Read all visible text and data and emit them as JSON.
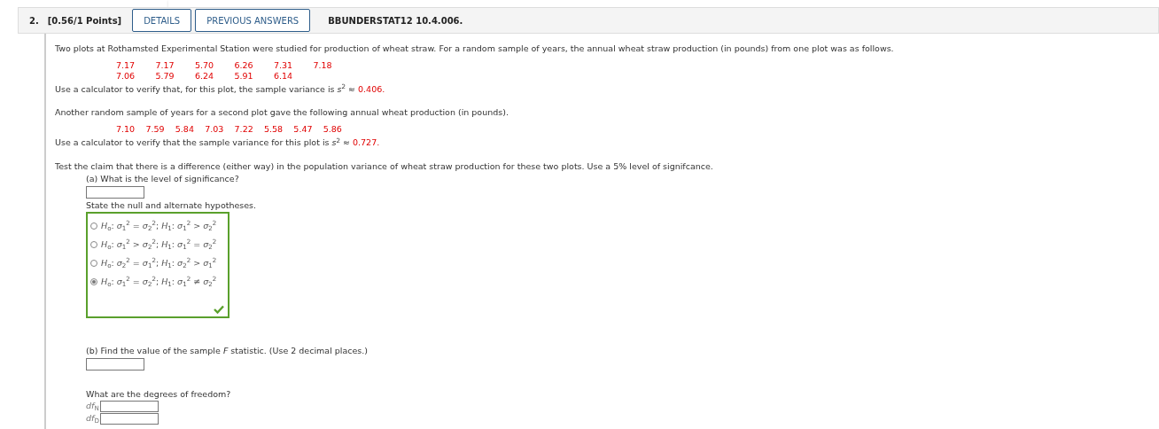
{
  "header": {
    "number": "2.",
    "points": "[0.56/1 Points]",
    "buttons": [
      "DETAILS",
      "PREVIOUS ANSWERS"
    ],
    "code": "BBUNDERSTAT12 10.4.006."
  },
  "intro": "Two plots at Rothamsted Experimental Station were studied for production of wheat straw. For a random sample of years, the annual wheat straw production (in pounds) from one plot was as follows.",
  "sample_1": [
    [
      "7.17",
      "7.17",
      "5.70",
      "6.26",
      "7.31",
      "7.18"
    ],
    [
      "7.06",
      "5.79",
      "6.24",
      "5.91",
      "6.14"
    ]
  ],
  "variance_1": {
    "text": "Use a calculator to verify that, for this plot, the sample variance is *s*$^{2}$ ≈",
    "value": "0.406."
  },
  "second_intro": "Another random sample of years for a second plot gave the following annual wheat production (in pounds).",
  "sample_2": [
    "7.10",
    "7.59",
    "5.84",
    "7.03",
    "7.22",
    "5.58",
    "5.47",
    "5.86"
  ],
  "variance_2": {
    "text": "Use a calculator to verify that the sample variance for this plot is *s*$^{2}$ ≈",
    "value": "0.727."
  },
  "claim": "Test the claim that there is a difference (either way) in the population variance of wheat straw production for these two plots. Use a 5% level of signifcance.",
  "part_a": {
    "question": "(a) What is the level of significance?",
    "hypotheses_prompt": "State the null and alternate hypotheses.",
    "options": [
      {
        "label": "*H*$_{o}$: *σ*$_{1}$$^{2}$ = *σ*$_{2}$$^{2}$; *H*$_{1}$: *σ*$_{1}$$^{2}$ > *σ*$_{2}$$^{2}$",
        "selected": false
      },
      {
        "label": "*H*$_{o}$: *σ*$_{1}$$^{2}$ > *σ*$_{2}$$^{2}$; *H*$_{1}$: *σ*$_{1}$$^{2}$ = *σ*$_{2}$$^{2}$",
        "selected": false
      },
      {
        "label": "*H*$_{o}$: *σ*$_{2}$$^{2}$ = *σ*$_{1}$$^{2}$; *H*$_{1}$: *σ*$_{2}$$^{2}$ > *σ*$_{1}$$^{2}$",
        "selected": false
      },
      {
        "label": "*H*$_{o}$: *σ*$_{1}$$^{2}$ = *σ*$_{2}$$^{2}$; *H*$_{1}$: *σ*$_{1}$$^{2}$ ≠ *σ*$_{2}$$^{2}$",
        "selected": true
      }
    ],
    "correct": true
  },
  "part_b": {
    "question": "(b) Find the value of the sample *F* statistic. (Use 2 decimal places.)",
    "df_prompt": "What are the degrees of freedom?",
    "df_labels": [
      "*df*$_{N}$",
      "*df*$_{D}$"
    ]
  }
}
